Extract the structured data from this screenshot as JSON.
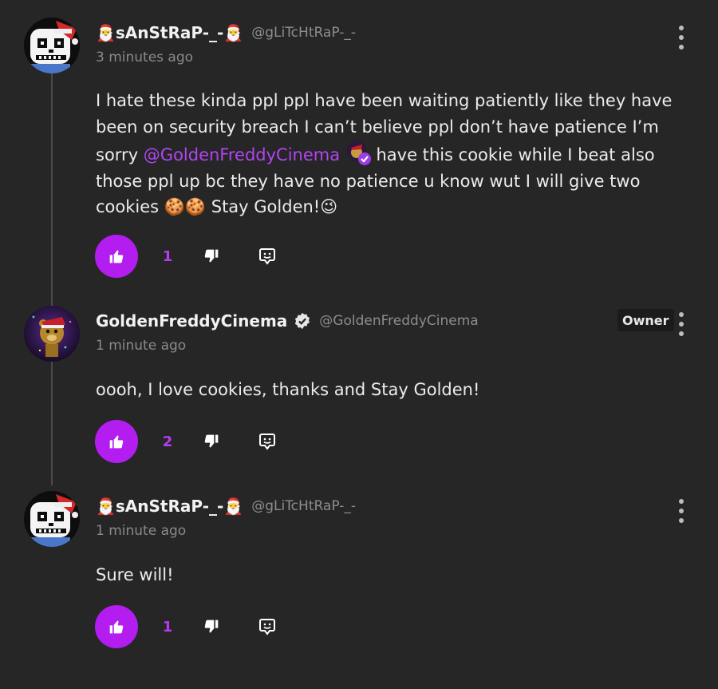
{
  "comments": [
    {
      "author_prefix_emoji": "🎅",
      "author": "sAnStRaP-_-",
      "author_suffix_emoji": "🎅",
      "handle": "@gLiTcHtRaP-_-",
      "time": "3 minutes ago",
      "text_part1": "I hate these kinda ppl ppl have been waiting patiently like they have been on security breach I can’t believe ppl don’t have patience I’m sorry ",
      "mention": "@GoldenFreddyCinema",
      "text_part2": " have this cookie while I beat also those ppl up bc they have no patience u know wut I will give two cookies 🍪🍪 Stay Golden!😉",
      "likes": "1"
    },
    {
      "author": "GoldenFreddyCinema",
      "handle": "@GoldenFreddyCinema",
      "badge": "Owner",
      "time": "1 minute ago",
      "text": "oooh, I love cookies, thanks and Stay Golden!",
      "likes": "2"
    },
    {
      "author_prefix_emoji": "🎅",
      "author": "sAnStRaP-_-",
      "author_suffix_emoji": "🎅",
      "handle": "@gLiTcHtRaP-_-",
      "time": "1 minute ago",
      "text": "Sure will!",
      "likes": "1"
    }
  ],
  "colors": {
    "background": "#262626",
    "accent": "#b31df0",
    "mention": "#b244f2"
  },
  "icons": [
    "thumbs-up-icon",
    "thumbs-down-icon",
    "reply-icon",
    "more-vertical-icon",
    "verified-check-icon"
  ]
}
